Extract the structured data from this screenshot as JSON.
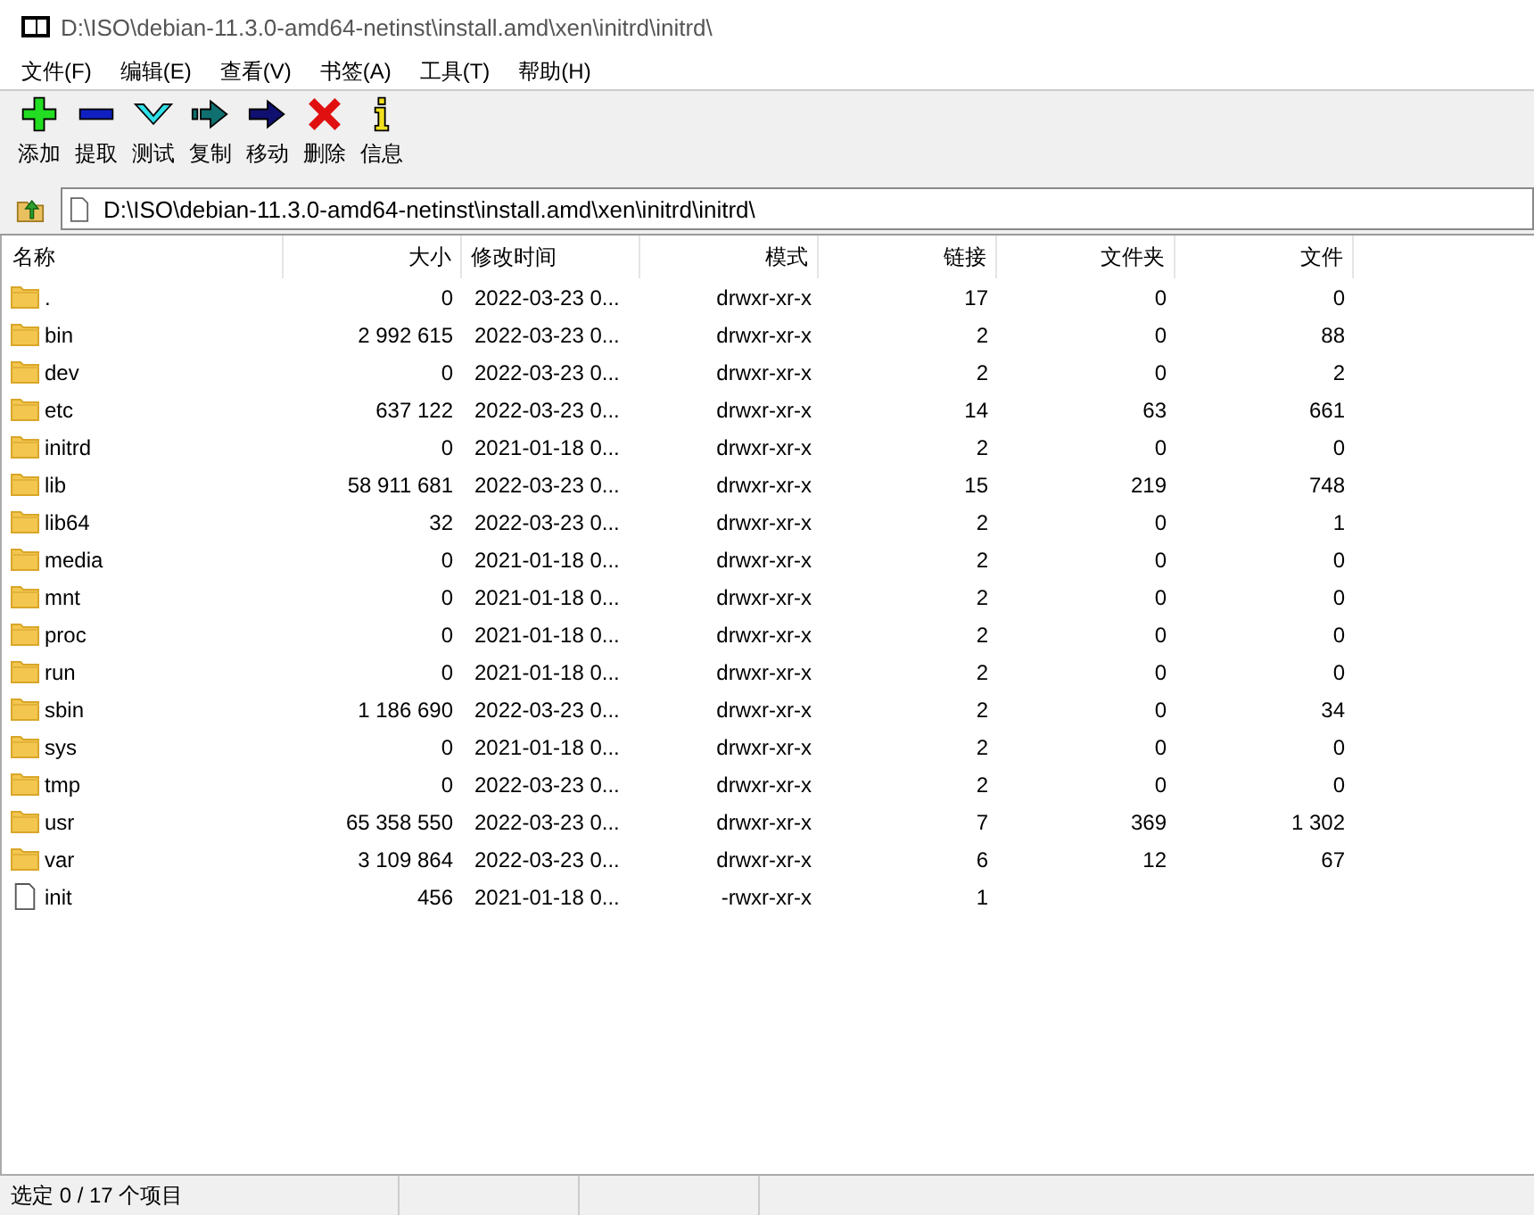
{
  "window": {
    "title": "D:\\ISO\\debian-11.3.0-amd64-netinst\\install.amd\\xen\\initrd\\initrd\\"
  },
  "menu": [
    "文件(F)",
    "编辑(E)",
    "查看(V)",
    "书签(A)",
    "工具(T)",
    "帮助(H)"
  ],
  "toolbar": [
    {
      "label": "添加",
      "kind": "add"
    },
    {
      "label": "提取",
      "kind": "extract"
    },
    {
      "label": "测试",
      "kind": "test"
    },
    {
      "label": "复制",
      "kind": "copy"
    },
    {
      "label": "移动",
      "kind": "move"
    },
    {
      "label": "删除",
      "kind": "delete"
    },
    {
      "label": "信息",
      "kind": "info"
    }
  ],
  "address": {
    "value": "D:\\ISO\\debian-11.3.0-amd64-netinst\\install.amd\\xen\\initrd\\initrd\\"
  },
  "table": {
    "columns": [
      "名称",
      "大小",
      "修改时间",
      "模式",
      "链接",
      "文件夹",
      "文件"
    ],
    "rows": [
      {
        "kind": "folder",
        "cells": [
          ".",
          "0",
          "2022-03-23 0...",
          "drwxr-xr-x",
          "17",
          "0",
          "0"
        ]
      },
      {
        "kind": "folder",
        "cells": [
          "bin",
          "2 992 615",
          "2022-03-23 0...",
          "drwxr-xr-x",
          "2",
          "0",
          "88"
        ]
      },
      {
        "kind": "folder",
        "cells": [
          "dev",
          "0",
          "2022-03-23 0...",
          "drwxr-xr-x",
          "2",
          "0",
          "2"
        ]
      },
      {
        "kind": "folder",
        "cells": [
          "etc",
          "637 122",
          "2022-03-23 0...",
          "drwxr-xr-x",
          "14",
          "63",
          "661"
        ]
      },
      {
        "kind": "folder",
        "cells": [
          "initrd",
          "0",
          "2021-01-18 0...",
          "drwxr-xr-x",
          "2",
          "0",
          "0"
        ]
      },
      {
        "kind": "folder",
        "cells": [
          "lib",
          "58 911 681",
          "2022-03-23 0...",
          "drwxr-xr-x",
          "15",
          "219",
          "748"
        ]
      },
      {
        "kind": "folder",
        "cells": [
          "lib64",
          "32",
          "2022-03-23 0...",
          "drwxr-xr-x",
          "2",
          "0",
          "1"
        ]
      },
      {
        "kind": "folder",
        "cells": [
          "media",
          "0",
          "2021-01-18 0...",
          "drwxr-xr-x",
          "2",
          "0",
          "0"
        ]
      },
      {
        "kind": "folder",
        "cells": [
          "mnt",
          "0",
          "2021-01-18 0...",
          "drwxr-xr-x",
          "2",
          "0",
          "0"
        ]
      },
      {
        "kind": "folder",
        "cells": [
          "proc",
          "0",
          "2021-01-18 0...",
          "drwxr-xr-x",
          "2",
          "0",
          "0"
        ]
      },
      {
        "kind": "folder",
        "cells": [
          "run",
          "0",
          "2021-01-18 0...",
          "drwxr-xr-x",
          "2",
          "0",
          "0"
        ]
      },
      {
        "kind": "folder",
        "cells": [
          "sbin",
          "1 186 690",
          "2022-03-23 0...",
          "drwxr-xr-x",
          "2",
          "0",
          "34"
        ]
      },
      {
        "kind": "folder",
        "cells": [
          "sys",
          "0",
          "2021-01-18 0...",
          "drwxr-xr-x",
          "2",
          "0",
          "0"
        ]
      },
      {
        "kind": "folder",
        "cells": [
          "tmp",
          "0",
          "2022-03-23 0...",
          "drwxr-xr-x",
          "2",
          "0",
          "0"
        ]
      },
      {
        "kind": "folder",
        "cells": [
          "usr",
          "65 358 550",
          "2022-03-23 0...",
          "drwxr-xr-x",
          "7",
          "369",
          "1 302"
        ]
      },
      {
        "kind": "folder",
        "cells": [
          "var",
          "3 109 864",
          "2022-03-23 0...",
          "drwxr-xr-x",
          "6",
          "12",
          "67"
        ]
      },
      {
        "kind": "file",
        "cells": [
          "init",
          "456",
          "2021-01-18 0...",
          "-rwxr-xr-x",
          "1"
        ]
      }
    ]
  },
  "status_bar": {
    "text": "选定 0 / 17 个项目"
  }
}
